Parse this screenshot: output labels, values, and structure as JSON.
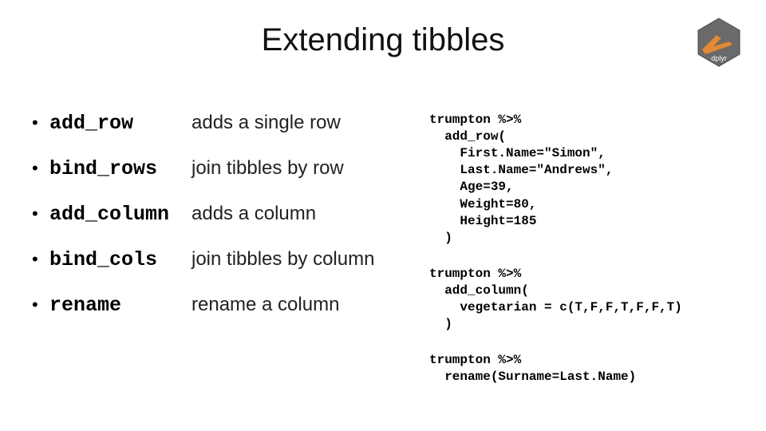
{
  "title": "Extending tibbles",
  "logo_label": "dplyr",
  "functions": [
    {
      "name": "add_row",
      "desc": "adds a single row"
    },
    {
      "name": "bind_rows",
      "desc": "join tibbles by row"
    },
    {
      "name": "add_column",
      "desc": "adds a column"
    },
    {
      "name": "bind_cols",
      "desc": "join tibbles by column"
    },
    {
      "name": "rename",
      "desc": "rename a column"
    }
  ],
  "code_blocks": [
    "trumpton %>%\n  add_row(\n    First.Name=\"Simon\",\n    Last.Name=\"Andrews\",\n    Age=39,\n    Weight=80,\n    Height=185\n  )",
    "trumpton %>%\n  add_column(\n    vegetarian = c(T,F,F,T,F,F,T)\n  )",
    "trumpton %>%\n  rename(Surname=Last.Name)"
  ]
}
